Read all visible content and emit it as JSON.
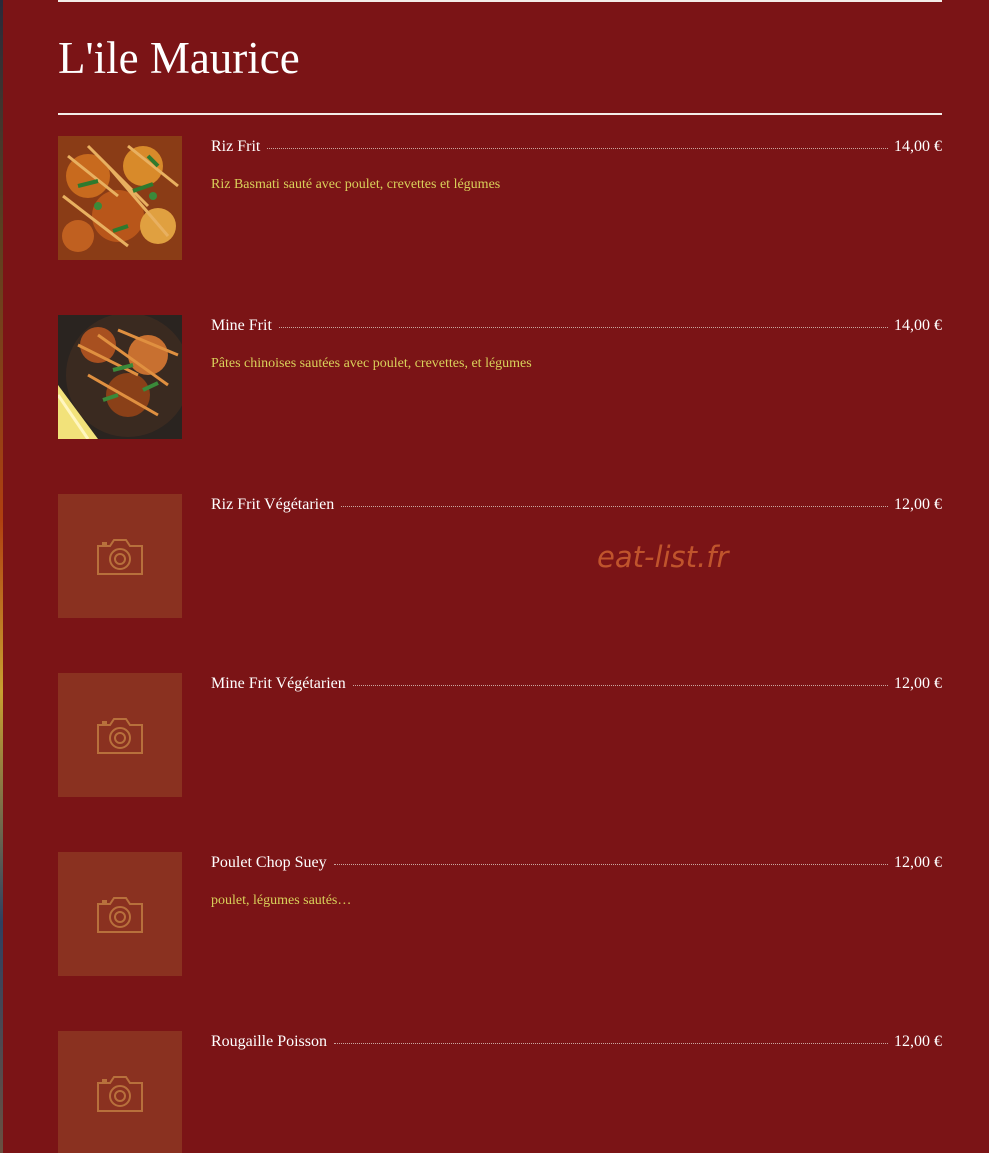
{
  "section": {
    "title": "L'ile Maurice"
  },
  "items": [
    {
      "name": "Riz Frit",
      "price": "14,00 €",
      "description": "Riz Basmati sauté avec poulet, crevettes et légumes",
      "image": "photo"
    },
    {
      "name": "Mine Frit",
      "price": "14,00 €",
      "description": "Pâtes chinoises sautées avec poulet, crevettes, et légumes",
      "image": "photo"
    },
    {
      "name": "Riz Frit Végétarien",
      "price": "12,00 €",
      "description": "",
      "image": "camera-placeholder-icon"
    },
    {
      "name": "Mine Frit Végétarien",
      "price": "12,00 €",
      "description": "",
      "image": "camera-placeholder-icon"
    },
    {
      "name": "Poulet Chop Suey",
      "price": "12,00 €",
      "description": "poulet, légumes sautés…",
      "image": "camera-placeholder-icon"
    },
    {
      "name": "Rougaille Poisson",
      "price": "12,00 €",
      "description": "",
      "image": "camera-placeholder-icon"
    }
  ],
  "watermark": "eat-list.fr",
  "colors": {
    "background": "#7b1416",
    "description_text": "#d9d05a",
    "placeholder_bg": "#8a3120",
    "placeholder_icon": "#b8703c",
    "watermark": "#c4582e"
  }
}
